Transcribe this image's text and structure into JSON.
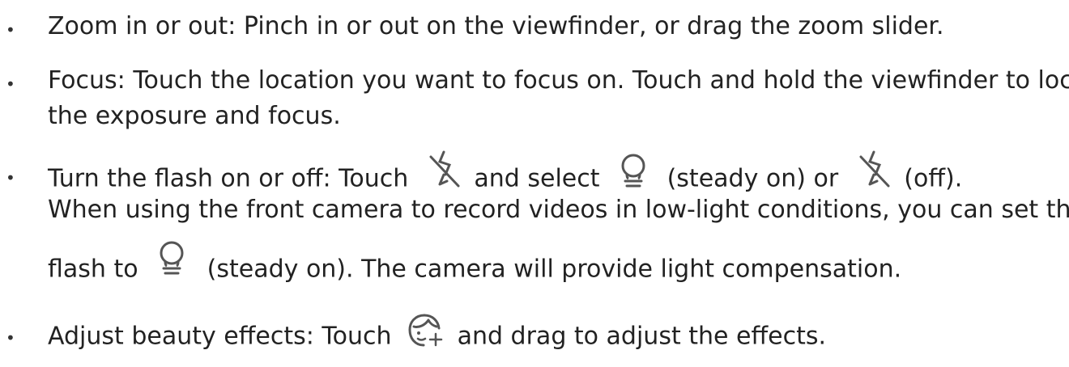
{
  "bullet_char": "•",
  "items": [
    {
      "text": "Zoom in or out: Pinch in or out on the viewfinder, or drag the zoom slider."
    },
    {
      "line1": "Focus: Touch the location you want to focus on. Touch and hold the viewfinder to lock",
      "line2": "the exposure and focus."
    },
    {
      "seg1": "Turn the flash on or off: Touch",
      "seg2": "and select",
      "seg3": "(steady on) or",
      "seg4": "(off).",
      "note_line1": "When using the front camera to record videos in low-light conditions, you can set the",
      "note_seg1": "flash to",
      "note_seg2": "(steady on). The camera will provide light compensation."
    },
    {
      "seg1": "Adjust beauty effects: Touch",
      "seg2": "and drag to adjust the effects."
    }
  ],
  "icons": {
    "flash_off": "flash-off-icon",
    "flash_steady_on": "flash-steady-on-icon",
    "beauty": "beauty-icon"
  }
}
